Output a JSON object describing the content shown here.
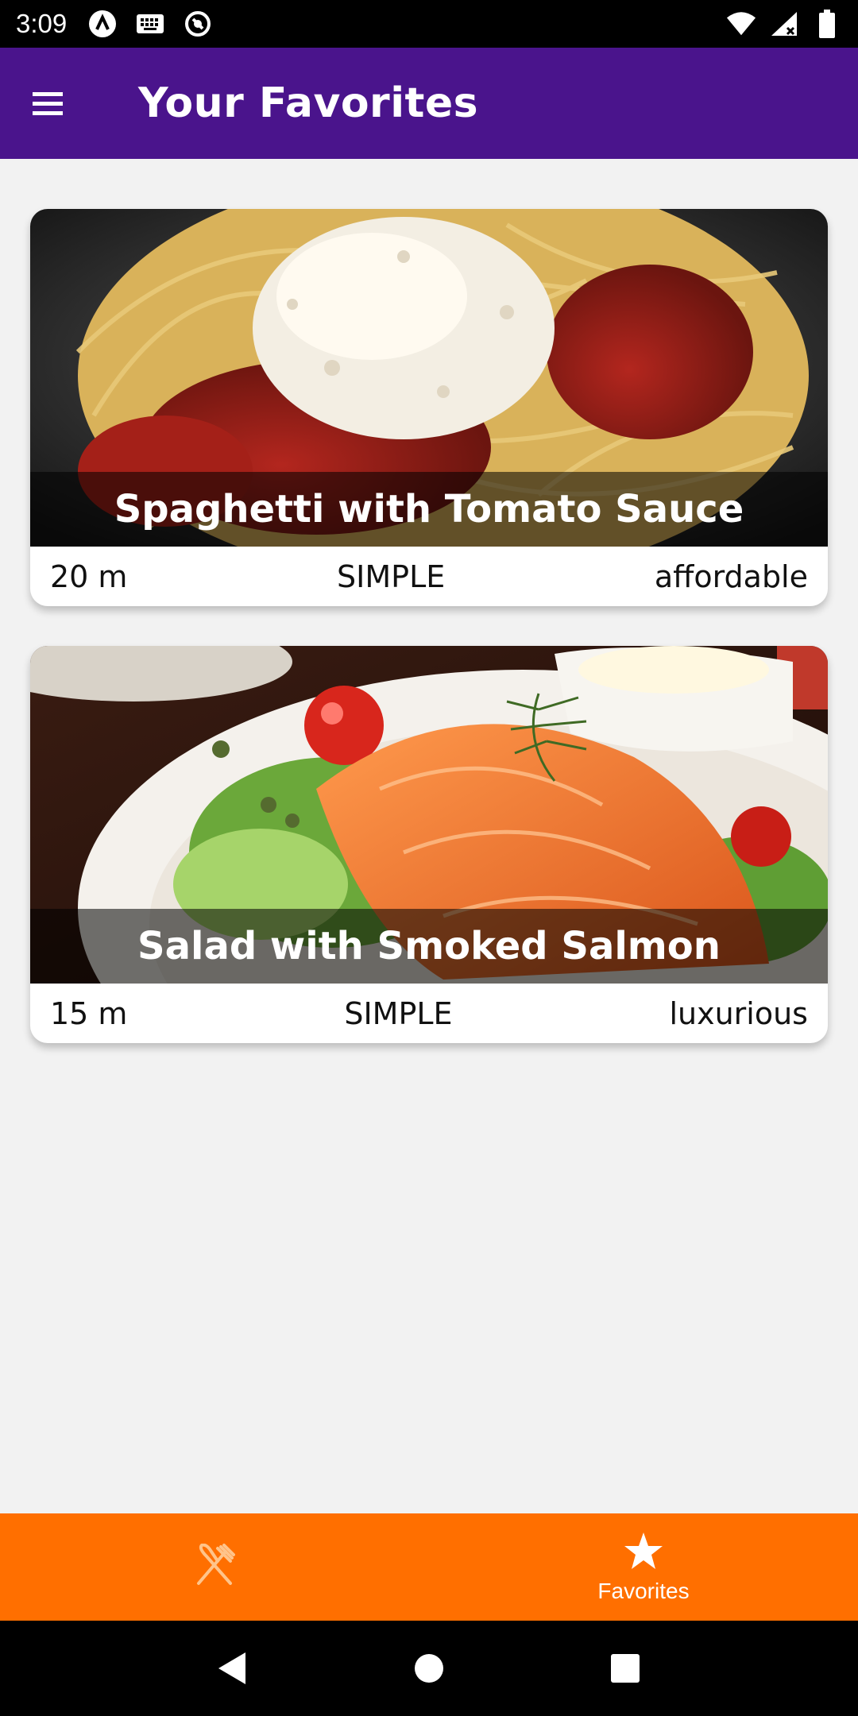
{
  "status_bar": {
    "time": "3:09",
    "left_icons": [
      "app-a-icon",
      "keyboard-icon",
      "sync-icon"
    ],
    "right_icons": [
      "wifi-icon",
      "signal-icon",
      "battery-icon"
    ]
  },
  "app_bar": {
    "title": "Your Favorites",
    "menu_icon": "hamburger-menu-icon",
    "background": "#4a148c"
  },
  "meals": [
    {
      "title": "Spaghetti with Tomato Sauce",
      "duration": "20 m",
      "complexity": "SIMPLE",
      "affordability": "affordable"
    },
    {
      "title": "Salad with Smoked Salmon",
      "duration": "15 m",
      "complexity": "SIMPLE",
      "affordability": "luxurious"
    }
  ],
  "bottom_tabs": {
    "background": "#ff6f00",
    "items": [
      {
        "icon": "restaurant-icon",
        "label": "",
        "active": false
      },
      {
        "icon": "star-icon",
        "label": "Favorites",
        "active": true
      }
    ]
  },
  "nav_bar": {
    "buttons": [
      "back-icon",
      "home-icon",
      "recents-icon"
    ]
  }
}
